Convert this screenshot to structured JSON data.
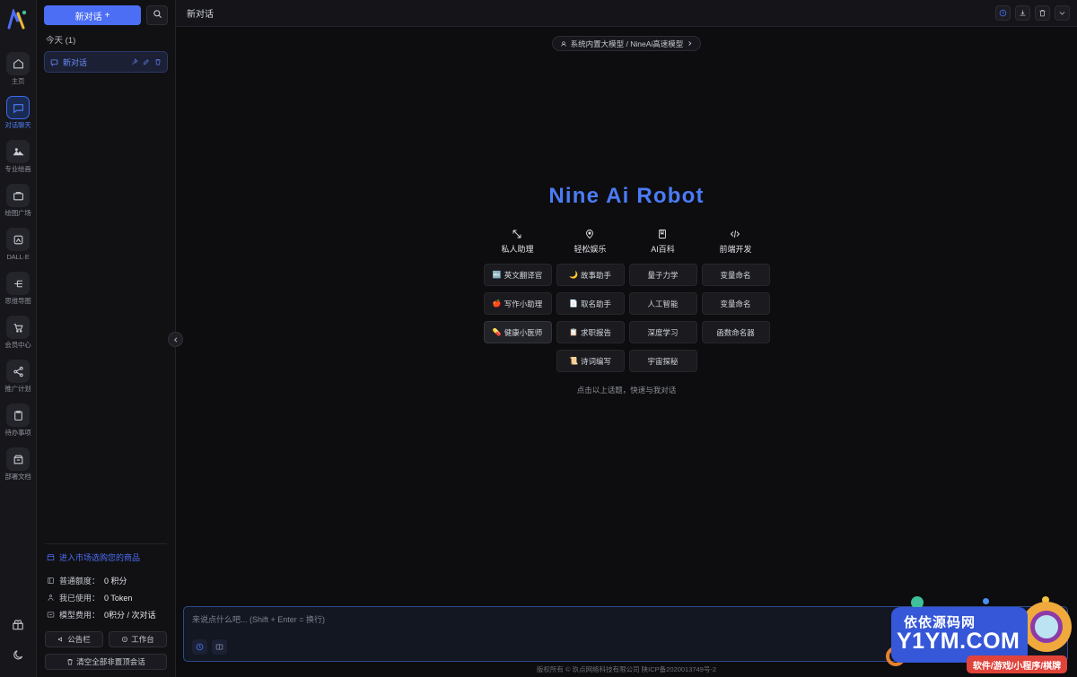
{
  "rail": {
    "logo_alt": "nine-ai-logo",
    "items": [
      {
        "label": "主页",
        "icon": "home-icon",
        "active": false
      },
      {
        "label": "对话聊天",
        "icon": "chat-icon",
        "active": true
      },
      {
        "label": "专业绘画",
        "icon": "image-icon",
        "active": false
      },
      {
        "label": "绘图广场",
        "icon": "gallery-icon",
        "active": false
      },
      {
        "label": "DALL·E",
        "icon": "dalle-icon",
        "active": false
      },
      {
        "label": "思维导图",
        "icon": "mindmap-icon",
        "active": false
      },
      {
        "label": "会员中心",
        "icon": "cart-icon",
        "active": false
      },
      {
        "label": "推广计划",
        "icon": "share-icon",
        "active": false
      },
      {
        "label": "待办事项",
        "icon": "clipboard-icon",
        "active": false
      },
      {
        "label": "部署文档",
        "icon": "doc-icon",
        "active": false
      }
    ],
    "bottom_icons": [
      {
        "name": "gift-icon"
      },
      {
        "name": "theme-toggle-icon"
      }
    ]
  },
  "sidebar": {
    "new_chat_label": "新对话",
    "new_chat_plus": "+",
    "search_icon": "search-icon",
    "group_label": "今天",
    "group_count": "(1)",
    "conversations": [
      {
        "title": "新对话",
        "icon": "chat-bubble-icon",
        "actions": [
          "pin-icon",
          "edit-icon",
          "delete-icon"
        ]
      }
    ],
    "market_link": "进入市场选购您的商品",
    "market_icon": "store-icon",
    "quota": [
      {
        "icon": "credit-icon",
        "label": "普通额度：",
        "value": "0 积分"
      },
      {
        "icon": "usage-icon",
        "label": "我已使用：",
        "value": "0 Token"
      },
      {
        "icon": "price-icon",
        "label": "模型费用：",
        "value": "0积分 / 次对话"
      }
    ],
    "buttons": [
      {
        "label": "公告栏",
        "icon": "megaphone-icon"
      },
      {
        "label": "工作台",
        "icon": "workbench-icon"
      }
    ],
    "clear_button": {
      "label": "清空全部非置顶会话",
      "icon": "trash-icon"
    },
    "collapse_icon": "chevron-left-icon"
  },
  "topbar": {
    "title": "新对话",
    "actions": [
      {
        "name": "history-icon",
        "accent": true
      },
      {
        "name": "download-icon",
        "accent": false
      },
      {
        "name": "delete-icon",
        "accent": false
      },
      {
        "name": "chevron-down-icon",
        "accent": false
      }
    ]
  },
  "model_selector": {
    "icon": "model-icon",
    "label": "系统内置大模型 / NineAi高速模型",
    "chevron": "chevron-right-icon"
  },
  "welcome": {
    "brand": "Nine Ai Robot",
    "categories": [
      {
        "label": "私人助理",
        "icon": "assistant-icon"
      },
      {
        "label": "轻松娱乐",
        "icon": "entertainment-icon"
      },
      {
        "label": "AI百科",
        "icon": "encyclopedia-icon"
      },
      {
        "label": "前端开发",
        "icon": "code-icon"
      }
    ],
    "topics": [
      {
        "label": "英文翻译官",
        "emoji": "🔤",
        "highlight": false
      },
      {
        "label": "故事助手",
        "emoji": "🌙",
        "highlight": false
      },
      {
        "label": "量子力学",
        "emoji": "",
        "highlight": false
      },
      {
        "label": "变量命名",
        "emoji": "",
        "highlight": false
      },
      {
        "label": "写作小助理",
        "emoji": "🍎",
        "highlight": false
      },
      {
        "label": "取名助手",
        "emoji": "📄",
        "highlight": false
      },
      {
        "label": "人工智能",
        "emoji": "",
        "highlight": false
      },
      {
        "label": "变量命名",
        "emoji": "",
        "highlight": false
      },
      {
        "label": "健康小医师",
        "emoji": "💊",
        "highlight": true
      },
      {
        "label": "求职报告",
        "emoji": "📋",
        "highlight": false
      },
      {
        "label": "深度学习",
        "emoji": "",
        "highlight": false
      },
      {
        "label": "函数命名器",
        "emoji": "",
        "highlight": false
      },
      {
        "label": "",
        "emoji": "",
        "highlight": false
      },
      {
        "label": "诗词编写",
        "emoji": "📜",
        "highlight": false
      },
      {
        "label": "宇宙探秘",
        "emoji": "",
        "highlight": false
      },
      {
        "label": "",
        "emoji": "",
        "highlight": false
      }
    ],
    "hint": "点击以上话题，快速与我对话"
  },
  "composer": {
    "placeholder": "来说点什么吧... (Shift + Enter = 换行)",
    "value": "",
    "tools": [
      {
        "name": "prompt-icon",
        "accent": true
      },
      {
        "name": "library-icon",
        "accent": false
      }
    ]
  },
  "footer": {
    "text": "版权所有 © 玖点网络科技有限公司 陕ICP备2020013749号-2"
  },
  "watermark": {
    "cn": "依依源码网",
    "en": "Y1YM.COM",
    "tags": "软件/游戏/小程序/棋牌"
  },
  "colors": {
    "accent": "#4b6ef5",
    "brand": "#4b7bf7",
    "bg": "#0d0d0f",
    "panel": "#111114",
    "rail": "#16161b"
  }
}
